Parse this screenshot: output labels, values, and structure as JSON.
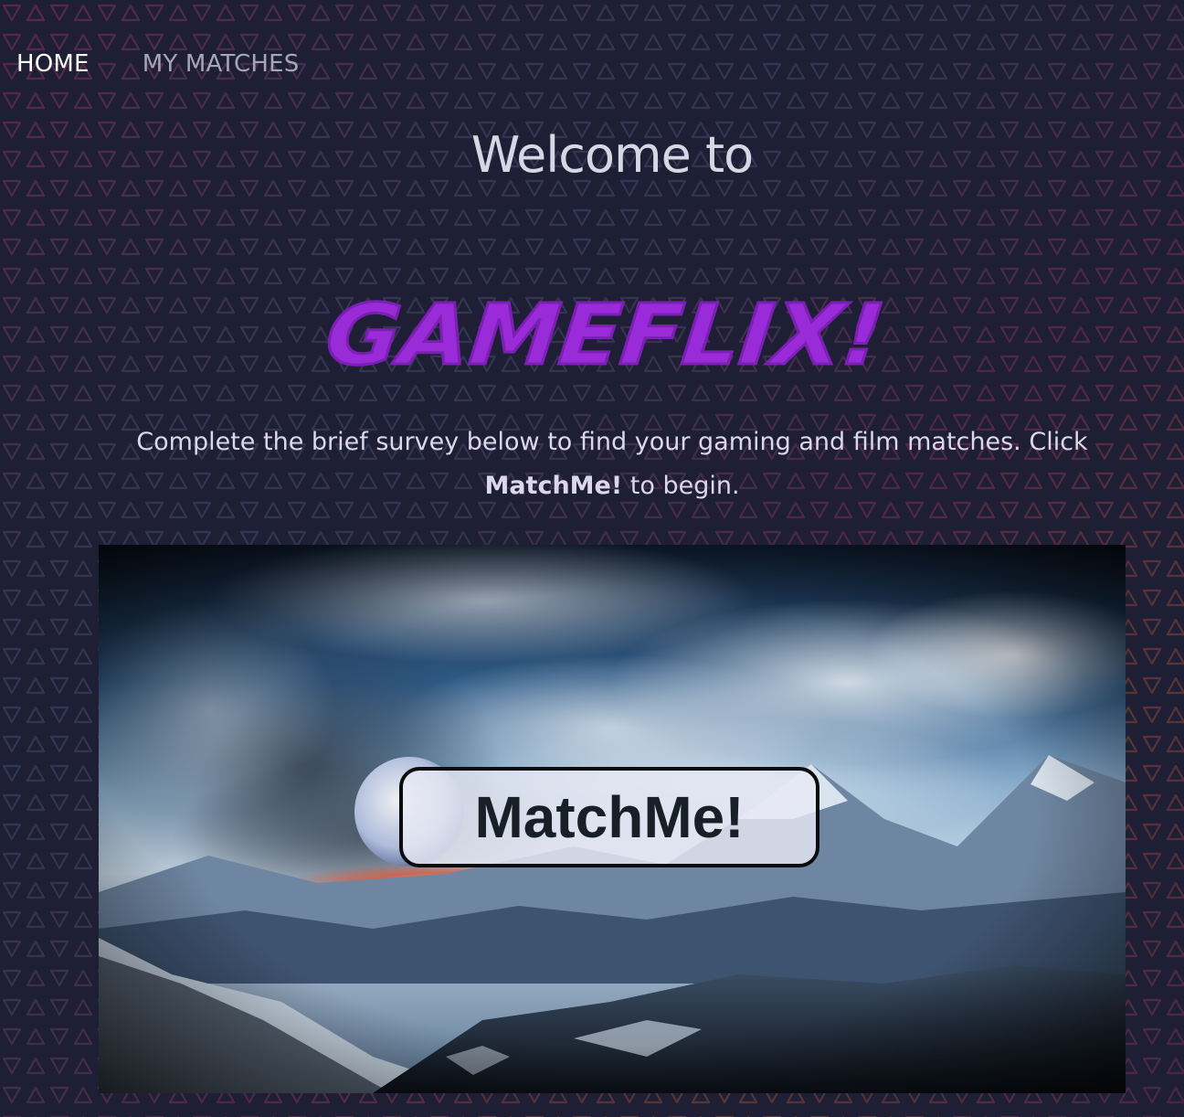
{
  "nav": {
    "home_label": "HOME",
    "matches_label": "MY MATCHES"
  },
  "header": {
    "welcome": "Welcome to",
    "logo_text": "GAMEFLIX!"
  },
  "intro": {
    "part1": "Complete the brief survey below to find your gaming and film matches. Click",
    "emphasis": "MatchMe!",
    "part2": "to begin."
  },
  "hero": {
    "button_label": "MatchMe!"
  },
  "colors": {
    "background": "#1e1f35",
    "logo": "#9a2bd8",
    "nav_active": "#ffffff",
    "nav_inactive": "#a5a6b6",
    "text": "#dcd7ea"
  }
}
